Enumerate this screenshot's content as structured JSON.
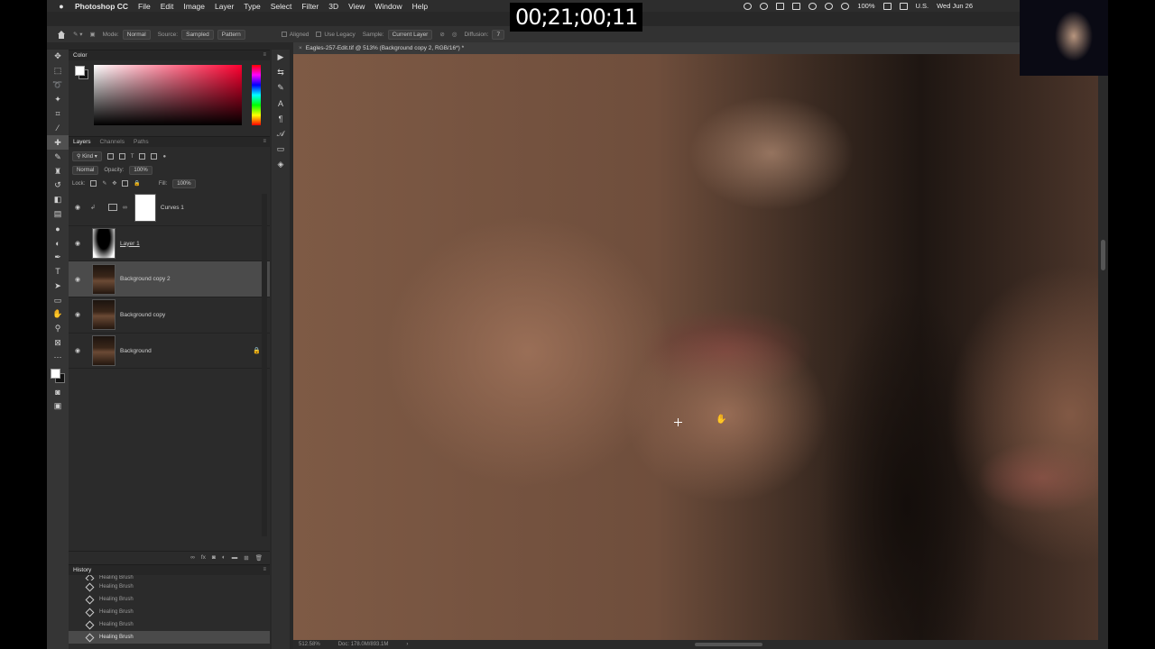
{
  "timecode": "00;21;00;11",
  "menubar": {
    "apple": "",
    "app_name": "Photoshop CC",
    "items": [
      "File",
      "Edit",
      "Image",
      "Layer",
      "Type",
      "Select",
      "Filter",
      "3D",
      "View",
      "Window",
      "Help"
    ],
    "battery": "100%",
    "locale": "U.S.",
    "datetime": "Wed Jun 26"
  },
  "options_bar": {
    "mode_label": "Mode:",
    "mode_value": "Normal",
    "source_label": "Source:",
    "source_sampled": "Sampled",
    "source_pattern": "Pattern",
    "aligned_label": "Aligned",
    "use_legacy_label": "Use Legacy",
    "sample_label": "Sample:",
    "sample_value": "Current Layer",
    "diffusion_label": "Diffusion:",
    "diffusion_value": "7"
  },
  "document": {
    "tab_title": "Eagles-257-Edit.tif @ 513% (Background copy 2, RGB/16*) *",
    "zoom": "512.58%",
    "doc_info": "Doc: 178.0M/893.1M"
  },
  "color_panel": {
    "tab": "Color"
  },
  "layers_panel": {
    "tabs": [
      "Layers",
      "Channels",
      "Paths"
    ],
    "kind_label": "Kind",
    "blend_mode": "Normal",
    "opacity_label": "Opacity:",
    "opacity_value": "100%",
    "lock_label": "Lock:",
    "fill_label": "Fill:",
    "fill_value": "100%",
    "layers": [
      {
        "name": "Curves 1"
      },
      {
        "name": "Layer 1"
      },
      {
        "name": "Background copy 2"
      },
      {
        "name": "Background copy"
      },
      {
        "name": "Background"
      }
    ]
  },
  "history_panel": {
    "tab": "History",
    "items": [
      "Healing Brush",
      "Healing Brush",
      "Healing Brush",
      "Healing Brush",
      "Healing Brush",
      "Healing Brush"
    ]
  },
  "colors": {
    "ui_bg": "#282828",
    "panel_bg": "#2b2b2b",
    "selected_layer": "#4b4b4b"
  }
}
